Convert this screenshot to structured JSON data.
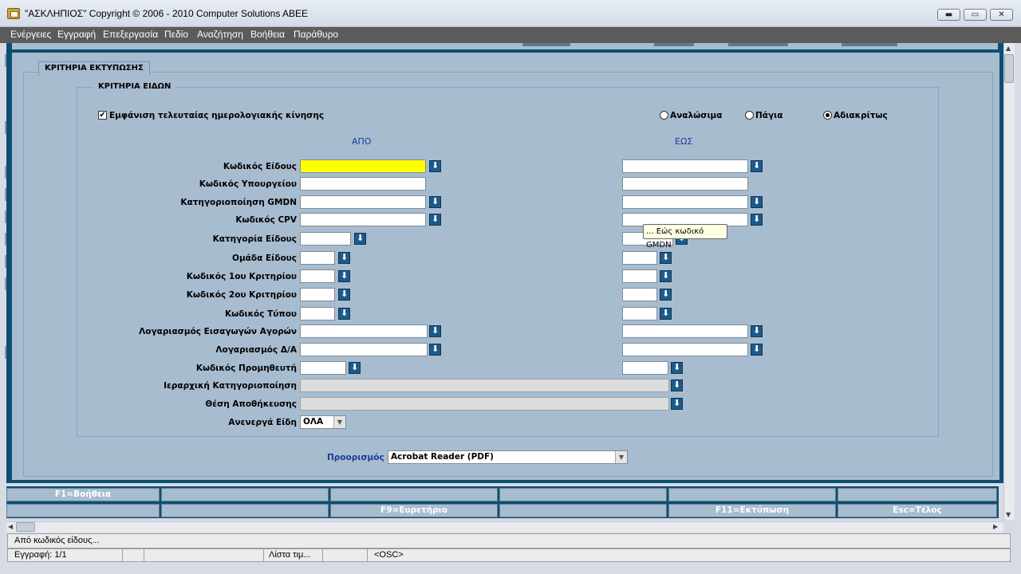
{
  "window": {
    "title": "\"ΑΣΚΛΗΠΙΟΣ\" Copyright © 2006 - 2010 Computer Solutions ABEE",
    "min_glyph": "▬",
    "max_glyph": "▭",
    "close_glyph": "✕"
  },
  "menu": [
    "Ενέργειες",
    "Εγγραφή",
    "Επεξεργασία",
    "Πεδίο",
    "Αναζήτηση",
    "Βοήθεια",
    "Παράθυρο"
  ],
  "form": {
    "print_criteria_title": "ΚΡΙΤΗΡΙΑ ΕΚΤΥΠΩΣΗΣ",
    "item_criteria_title": "ΚΡΙΤΗΡΙΑ ΕΙΔΩΝ",
    "show_last_movement": {
      "label": "Εμφάνιση τελευταίας ημερολογιακής κίνησης",
      "checked": true,
      "mark": "✔"
    },
    "radios": [
      {
        "label": "Αναλώσιμα",
        "selected": false
      },
      {
        "label": "Πάγια",
        "selected": false
      },
      {
        "label": "Αδιακρίτως",
        "selected": true
      }
    ],
    "from_header": "ΑΠΟ",
    "to_header": "ΕΩΣ",
    "rows": [
      "Κωδικός Είδους",
      "Κωδικός Υπουργείου",
      "Κατηγοριοποίηση GMDN",
      "Κωδικός CPV",
      "Κατηγορία Είδους",
      "Ομάδα Είδους",
      "Κωδικός 1ου Κριτηρίου",
      "Κωδικός 2ου Κριτηρίου",
      "Κωδικός Τύπου",
      "Λογαριασμός Εισαγωγών Αγορών",
      "Λογαριασμός Δ/Α",
      "Κωδικός Προμηθευτή",
      "Ιεραρχική Κατηγοριοποίηση",
      "Θέση Αποθήκευσης",
      "Ανενεργά Είδη"
    ],
    "inactive_items_value": "ΟΛΑ",
    "destination_label": "Προορισμός",
    "destination_value": "Acrobat Reader (PDF)",
    "tooltip": "... Εώς κωδικό GMDN"
  },
  "fkeys": {
    "row1": [
      "F1=Βοήθεια",
      "",
      "",
      "",
      "",
      ""
    ],
    "row2": [
      "",
      "",
      "F9=Ευρετήριο",
      "",
      "F11=Εκτύπωση",
      "Esc=Τέλος"
    ]
  },
  "status": {
    "message": "Από κωδικός είδους...",
    "record": "Εγγραφή: 1/1",
    "list": "Λίστα τιμ...",
    "osc": "<OSC>"
  },
  "colors": {
    "menubar": "#5b5b5b",
    "frame": "#0c4f73",
    "panel": "#a8bccf",
    "current_field": "#ffff00"
  }
}
